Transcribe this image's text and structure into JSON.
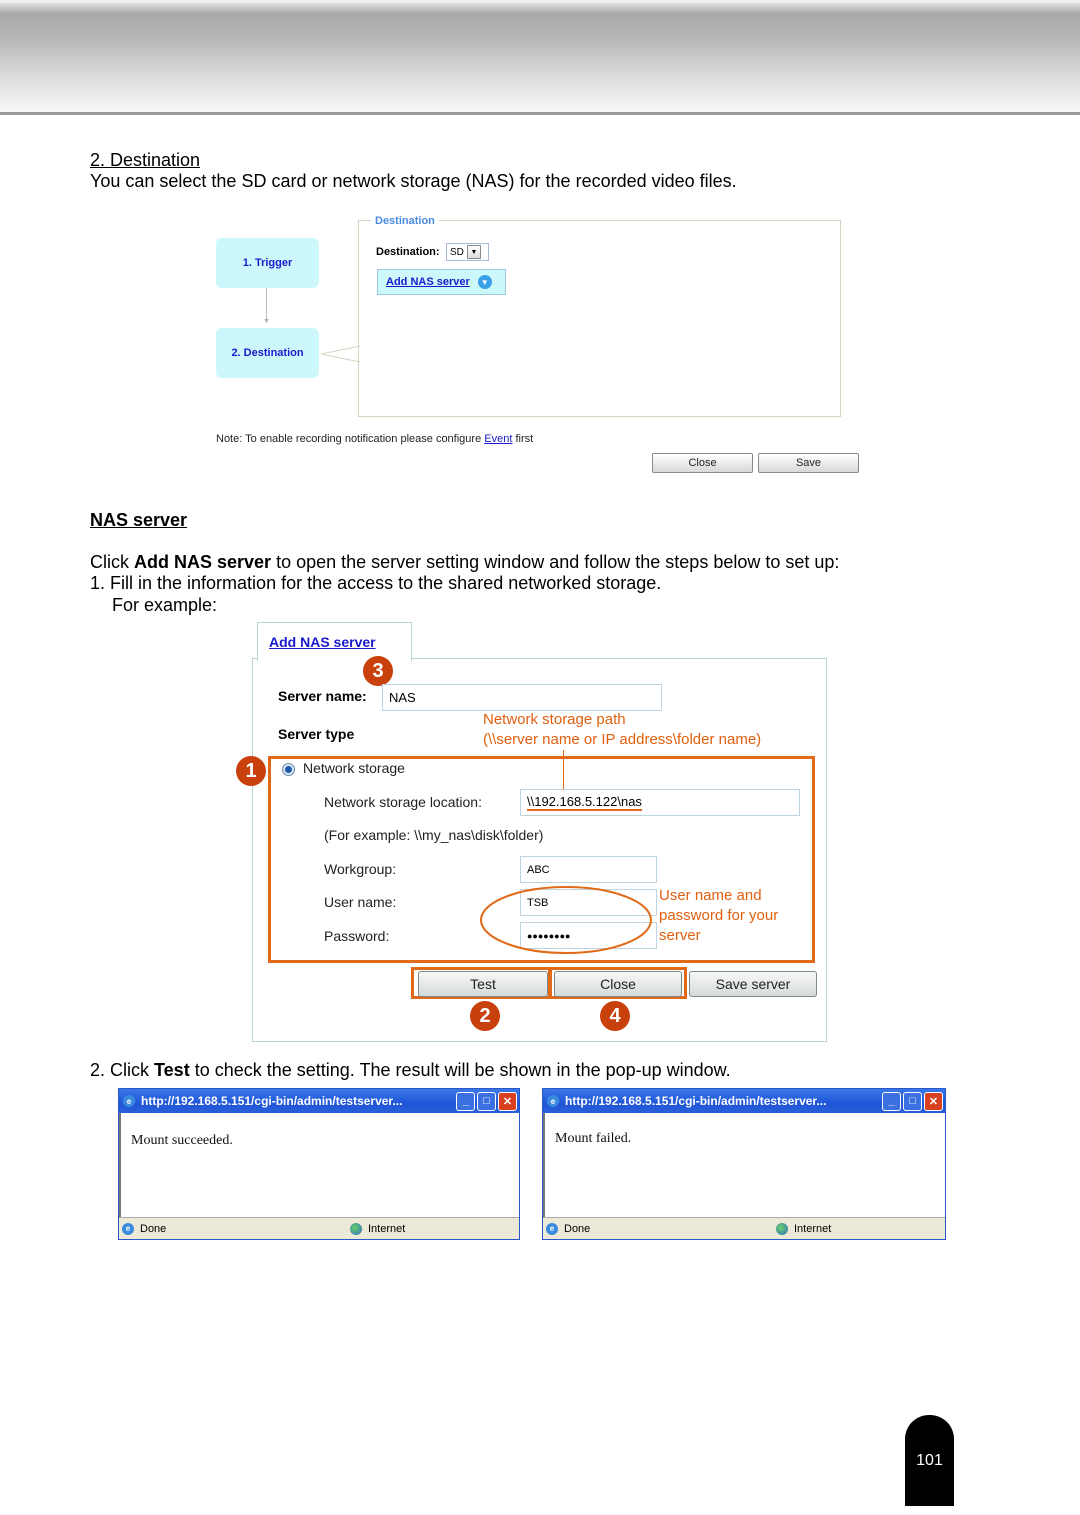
{
  "section": {
    "heading": "2. Destination",
    "intro": "You can select the SD card or network storage (NAS) for the recorded video files."
  },
  "destination_screenshot": {
    "steps": [
      "1. Trigger",
      "2. Destination"
    ],
    "legend": "Destination",
    "destination_label": "Destination:",
    "destination_value": "SD",
    "add_nas_link": "Add NAS server",
    "note_prefix": "Note: To enable recording notification please configure ",
    "note_link": "Event",
    "note_suffix": " first",
    "close_button": "Close",
    "save_button": "Save"
  },
  "nas_section": {
    "heading": "NAS server",
    "instruction_prefix": "Click ",
    "instruction_bold": "Add NAS server",
    "instruction_suffix": " to open the server setting window and follow the steps below to set up:",
    "step1": "1. Fill in the information for the access to the shared networked storage.",
    "for_example": "For example:"
  },
  "nas_screenshot": {
    "tab_label": "Add NAS server",
    "server_name_label": "Server name:",
    "server_name_value": "NAS",
    "server_type_label": "Server type",
    "annotation_path_line1": "Network storage path",
    "annotation_path_line2": "(\\\\server name or IP address\\folder name)",
    "radio_label": "Network storage",
    "location_label": "Network storage location:",
    "location_value": "\\\\192.168.5.122\\nas",
    "example_hint": "(For example: \\\\my_nas\\disk\\folder)",
    "workgroup_label": "Workgroup:",
    "workgroup_value": "ABC",
    "username_label": "User name:",
    "username_value": "TSB",
    "password_label": "Password:",
    "password_value": "●●●●●●●●",
    "annotation_cred_line1": "User name and",
    "annotation_cred_line2": "password for your",
    "annotation_cred_line3": "server",
    "test_button": "Test",
    "close_button": "Close",
    "save_server_button": "Save server",
    "badges": [
      "1",
      "2",
      "3",
      "4"
    ]
  },
  "step2": {
    "prefix": "2. Click ",
    "bold": "Test",
    "suffix": " to check the setting. The result will be shown in the pop-up window."
  },
  "popups": [
    {
      "title": "http://192.168.5.151/cgi-bin/admin/testserver...",
      "message": "Mount succeeded.",
      "status_left": "Done",
      "status_zone": "Internet"
    },
    {
      "title": "http://192.168.5.151/cgi-bin/admin/testserver...",
      "message": "Mount failed.",
      "status_left": "Done",
      "status_zone": "Internet"
    }
  ],
  "window_controls": {
    "minimize": "_",
    "maximize": "□",
    "close": "✕"
  },
  "page_number": "101",
  "colors": {
    "annotation_orange": "#e06a18",
    "badge_red": "#c8400c",
    "link_blue": "#1a1acc"
  }
}
